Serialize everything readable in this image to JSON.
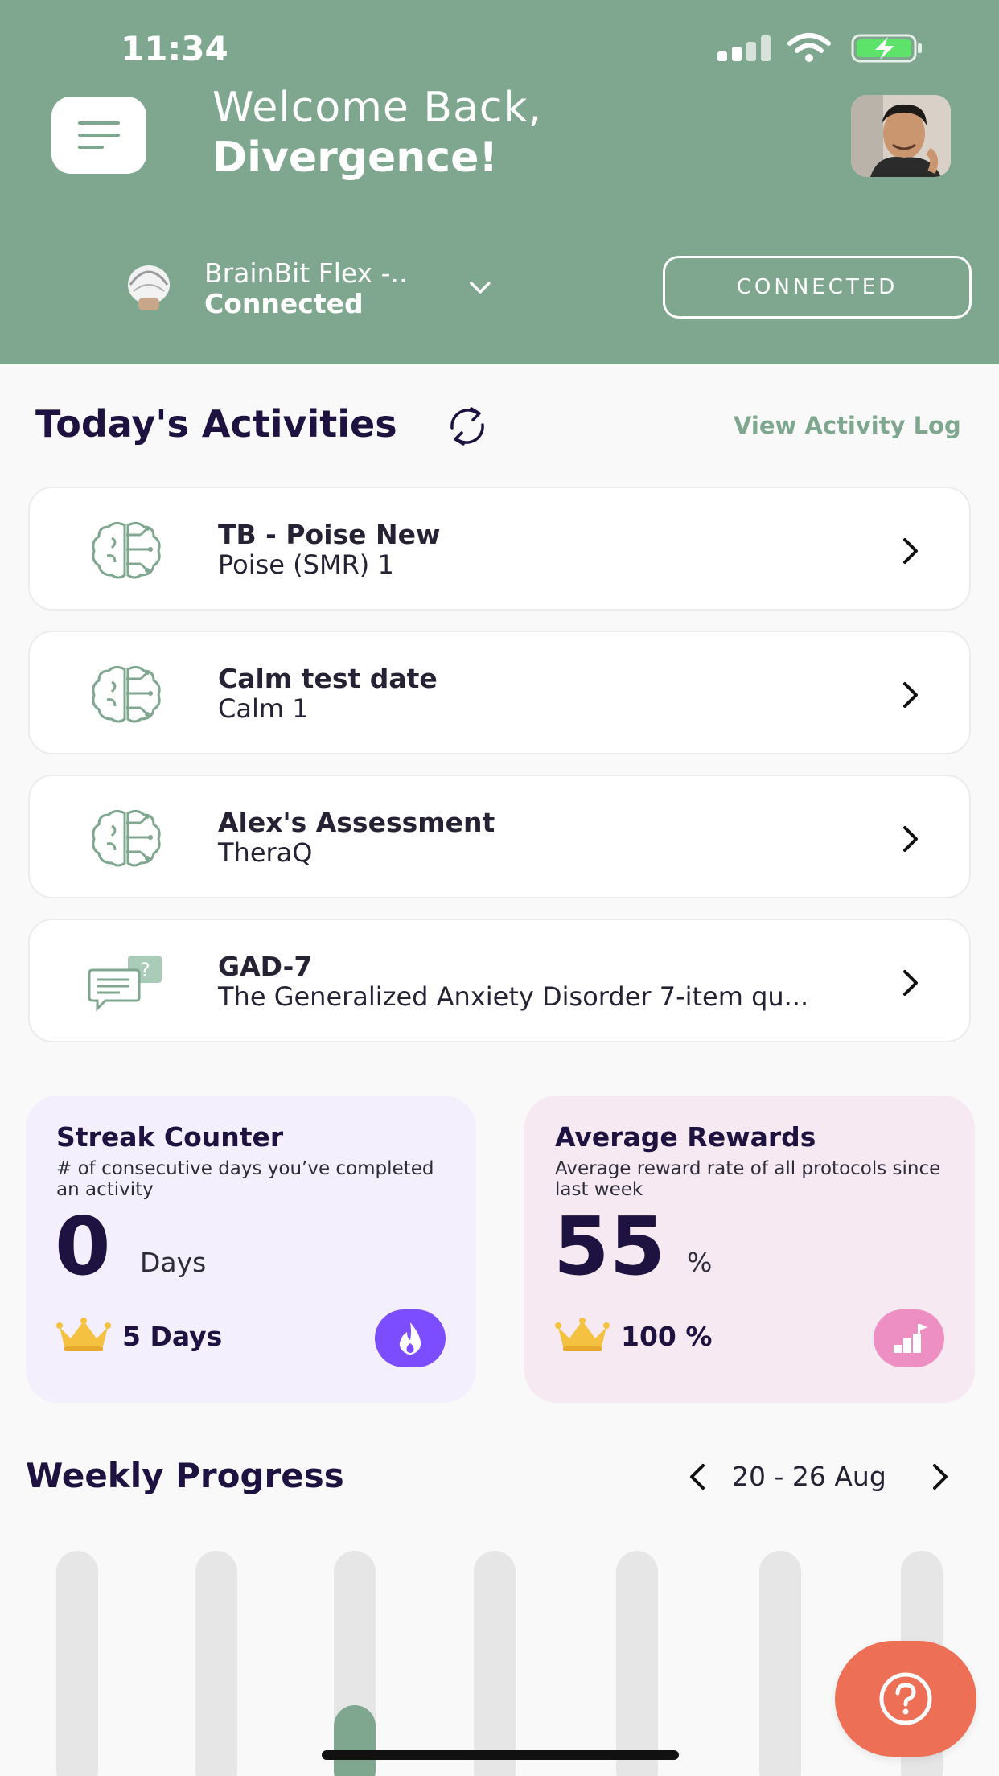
{
  "colors": {
    "header_bg": "#7fa78f",
    "accent_green": "#7fa78f",
    "streak_card_bg": "#f3effd",
    "rewards_card_bg": "#f7e9f1",
    "streak_badge": "#7c4dff",
    "rewards_badge": "#ee8fc4",
    "help_button": "#ec6f56",
    "bar_fill": "#7fa78f",
    "bar_track": "#e6e6e6"
  },
  "status_bar": {
    "time": "11:34"
  },
  "header": {
    "greeting_line1": "Welcome Back,",
    "greeting_line2": "Divergence!",
    "menu_icon": "menu-icon",
    "avatar_icon": "avatar"
  },
  "device": {
    "name": "BrainBit Flex -..",
    "status": "Connected",
    "connection_button": "CONNECTED"
  },
  "activities": {
    "title": "Today's Activities",
    "view_log": "View Activity Log",
    "items": [
      {
        "title": "TB - Poise New",
        "subtitle": "Poise (SMR) 1",
        "icon": "brain-icon"
      },
      {
        "title": "Calm test date",
        "subtitle": "Calm 1",
        "icon": "brain-icon"
      },
      {
        "title": "Alex's Assessment",
        "subtitle": "TheraQ",
        "icon": "brain-icon"
      },
      {
        "title": "GAD-7",
        "subtitle": "The Generalized Anxiety Disorder 7-item qu...",
        "icon": "questionnaire-icon"
      }
    ]
  },
  "streak": {
    "title": "Streak Counter",
    "description": "# of consecutive days you’ve completed an activity",
    "value": "0",
    "unit": "Days",
    "best": "5 Days",
    "badge_icon": "flame-icon"
  },
  "rewards": {
    "title": "Average Rewards",
    "description": "Average reward rate of all protocols since last week",
    "value": "55",
    "unit": "%",
    "best": "100 %",
    "badge_icon": "chart-flag-icon"
  },
  "weekly": {
    "title": "Weekly Progress",
    "range": "20 - 26 Aug",
    "bar_levels": [
      0,
      0,
      0.36,
      0,
      0,
      0,
      0
    ]
  }
}
